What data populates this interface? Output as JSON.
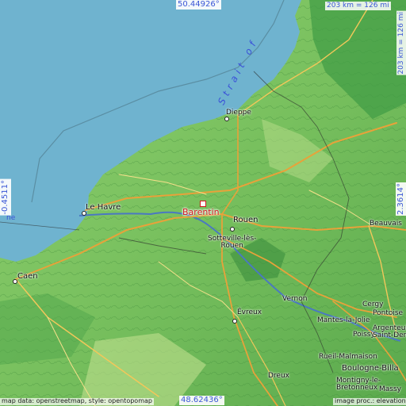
{
  "map": {
    "target": "Barentin",
    "coords": {
      "top": "50.44926°",
      "bottom": "48.62436°",
      "left": "-0.4511°",
      "right": "2.3614°"
    },
    "scale": {
      "top": "203 km = 126 mi",
      "right": "203 km = 126 mi"
    },
    "water_label": "Strait of",
    "water_fragment": "ne",
    "attribution_left": "map data: openstreetmap, style: opentopomap",
    "attribution_right": "image proc.: elevationsmap",
    "places": {
      "dieppe": "Dieppe",
      "le_havre": "Le Havre",
      "rouen": "Rouen",
      "sotteville": "Sotteville-lès-\nRouen",
      "caen": "Caen",
      "evreux": "Évreux",
      "vernon": "Vernon",
      "beauvais": "Beauvais",
      "cergy": "Cergy",
      "pontoise": "Pontoise",
      "mantes": "Mantes-la-Jolie",
      "argenteuil": "Argenteuil",
      "poissy": "Poissy",
      "saint_denis": "Saint-Denis",
      "rueil": "Rueil-Malmaison",
      "boulogne": "Boulogne-Billa",
      "montigny": "Montigny-le-\nBretonneux",
      "massy": "Massy",
      "dreux": "Dreux"
    },
    "colors": {
      "sea": "#6fb3cf",
      "land_low": "#9fd17a",
      "land_mid": "#5fae52",
      "land_high": "#2f8a3f",
      "target": "#d0191e",
      "coord_text": "#3a56d6"
    }
  }
}
